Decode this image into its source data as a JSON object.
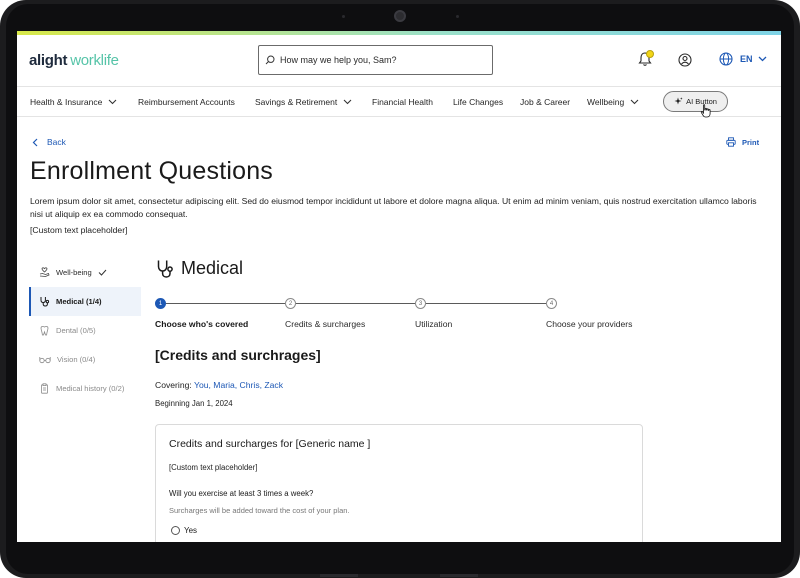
{
  "header": {
    "logo_primary": "alight",
    "logo_secondary": "worklife",
    "search_placeholder": "How may we help you, Sam?",
    "language": "EN"
  },
  "nav": {
    "items": [
      {
        "label": "Health & Insurance",
        "dropdown": true
      },
      {
        "label": "Reimbursement Accounts",
        "dropdown": false
      },
      {
        "label": "Savings & Retirement",
        "dropdown": true
      },
      {
        "label": "Financial Health",
        "dropdown": false
      },
      {
        "label": "Life Changes",
        "dropdown": false
      },
      {
        "label": "Job & Career",
        "dropdown": false
      },
      {
        "label": "Wellbeing",
        "dropdown": true
      }
    ],
    "ai_button": "AI Button"
  },
  "page": {
    "back": "Back",
    "print": "Print",
    "title": "Enrollment Questions",
    "intro": "Lorem ipsum dolor sit amet, consectetur adipiscing elit. Sed do eiusmod tempor incididunt ut labore et dolore magna aliqua. Ut enim ad minim veniam, quis nostrud exercitation ullamco laboris nisi ut aliquip ex ea commodo consequat.",
    "custom_placeholder": "[Custom text placeholder]"
  },
  "steps": [
    {
      "label": "Well-being",
      "state": "done",
      "icon": "hand-heart-icon"
    },
    {
      "label": "Medical (1/4)",
      "state": "active",
      "icon": "stethoscope-icon"
    },
    {
      "label": "Dental (0/5)",
      "state": "pending",
      "icon": "tooth-icon"
    },
    {
      "label": "Vision (0/4)",
      "state": "pending",
      "icon": "glasses-icon"
    },
    {
      "label": "Medical history (0/2)",
      "state": "pending",
      "icon": "clipboard-icon"
    }
  ],
  "main": {
    "section_title": "Medical",
    "progress": [
      {
        "num": "1",
        "label": "Choose who's covered",
        "active": true
      },
      {
        "num": "2",
        "label": "Credits & surcharges",
        "active": false
      },
      {
        "num": "3",
        "label": "Utilization",
        "active": false
      },
      {
        "num": "4",
        "label": "Choose your providers",
        "active": false
      }
    ],
    "sub_title": "[Credits and surchrages]",
    "covering_label": "Covering:",
    "covering_who": "You, Maria, Chris, Zack",
    "beginning": "Beginning Jan 1, 2024",
    "card": {
      "title": "Credits and surcharges for [Generic name ]",
      "placeholder": "[Custom text placeholder]",
      "question": "Will you exercise at least 3 times a week?",
      "note": "Surcharges will be added toward the cost of your plan.",
      "option_yes": "Yes"
    }
  },
  "colors": {
    "accent_blue": "#1d58b5",
    "brand_green": "#56c4a8",
    "notification_yellow": "#f2d517"
  }
}
